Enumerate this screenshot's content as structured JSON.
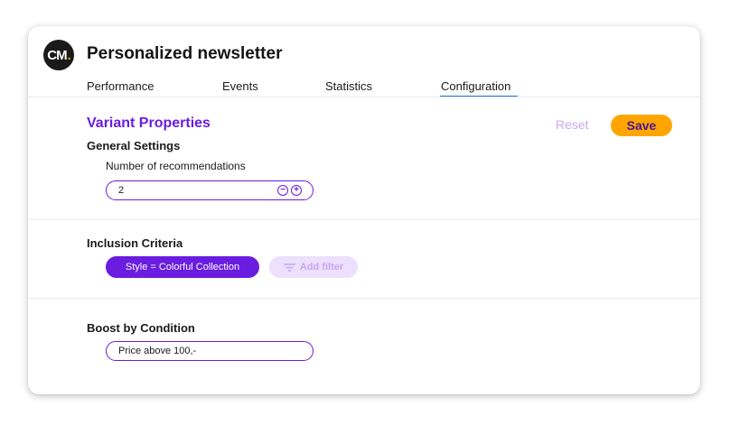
{
  "app": {
    "logo_text": "CM",
    "logo_dot": ".",
    "title": "Personalized newsletter"
  },
  "tabs": [
    {
      "label": "Performance",
      "active": false
    },
    {
      "label": "Events",
      "active": false
    },
    {
      "label": "Statistics",
      "active": false
    },
    {
      "label": "Configuration",
      "active": true
    }
  ],
  "variant": {
    "heading": "Variant Properties",
    "reset_label": "Reset",
    "save_label": "Save",
    "general_settings": {
      "heading": "General Settings",
      "recommendations_label": "Number of recommendations",
      "recommendations_value": "2",
      "decrement": "−",
      "increment": "+"
    }
  },
  "inclusion": {
    "heading": "Inclusion Criteria",
    "filter_chip": "Style = Colorful Collection",
    "add_filter_label": "Add filter"
  },
  "boost": {
    "heading": "Boost by Condition",
    "condition_value": "Price above 100,-"
  },
  "colors": {
    "accent_purple": "#6a1ce0",
    "save_orange": "#ffa500",
    "tab_underline": "#1a73e8"
  },
  "icons": {
    "logo": "cm-logo-icon",
    "filter": "filter-icon",
    "minus": "minus-circle-icon",
    "plus": "plus-circle-icon"
  }
}
